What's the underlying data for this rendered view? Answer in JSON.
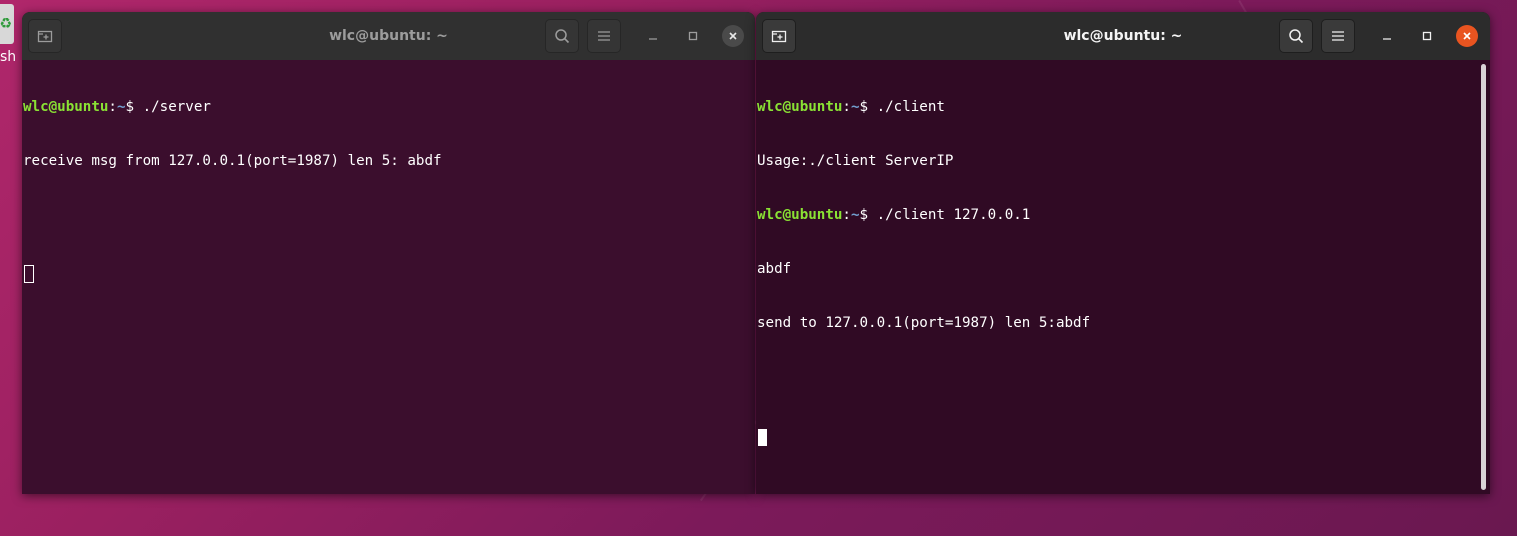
{
  "desktop": {
    "icon_label": "sh"
  },
  "left_window": {
    "title": "wlc@ubuntu: ~",
    "lines": [
      {
        "user": "wlc@ubuntu",
        "colon": ":",
        "path": "~",
        "rest": "$ ./server"
      },
      {
        "text": "receive msg from 127.0.0.1(port=1987) len 5: abdf"
      }
    ]
  },
  "right_window": {
    "title": "wlc@ubuntu: ~",
    "lines": [
      {
        "user": "wlc@ubuntu",
        "colon": ":",
        "path": "~",
        "rest": "$ ./client"
      },
      {
        "text": "Usage:./client ServerIP"
      },
      {
        "user": "wlc@ubuntu",
        "colon": ":",
        "path": "~",
        "rest": "$ ./client 127.0.0.1"
      },
      {
        "text": "abdf"
      },
      {
        "text": "send to 127.0.0.1(port=1987) len 5:abdf"
      }
    ]
  },
  "icons": {
    "new_tab": "new-tab-icon",
    "search": "search-icon",
    "menu": "hamburger-menu-icon",
    "minimize": "minimize-icon",
    "maximize": "maximize-icon",
    "close": "close-icon"
  },
  "colors": {
    "terminal_bg": "#300a24",
    "prompt_user": "#8ae234",
    "prompt_path": "#729fcf",
    "close_active": "#e95420",
    "titlebar": "#2c2c2c"
  }
}
